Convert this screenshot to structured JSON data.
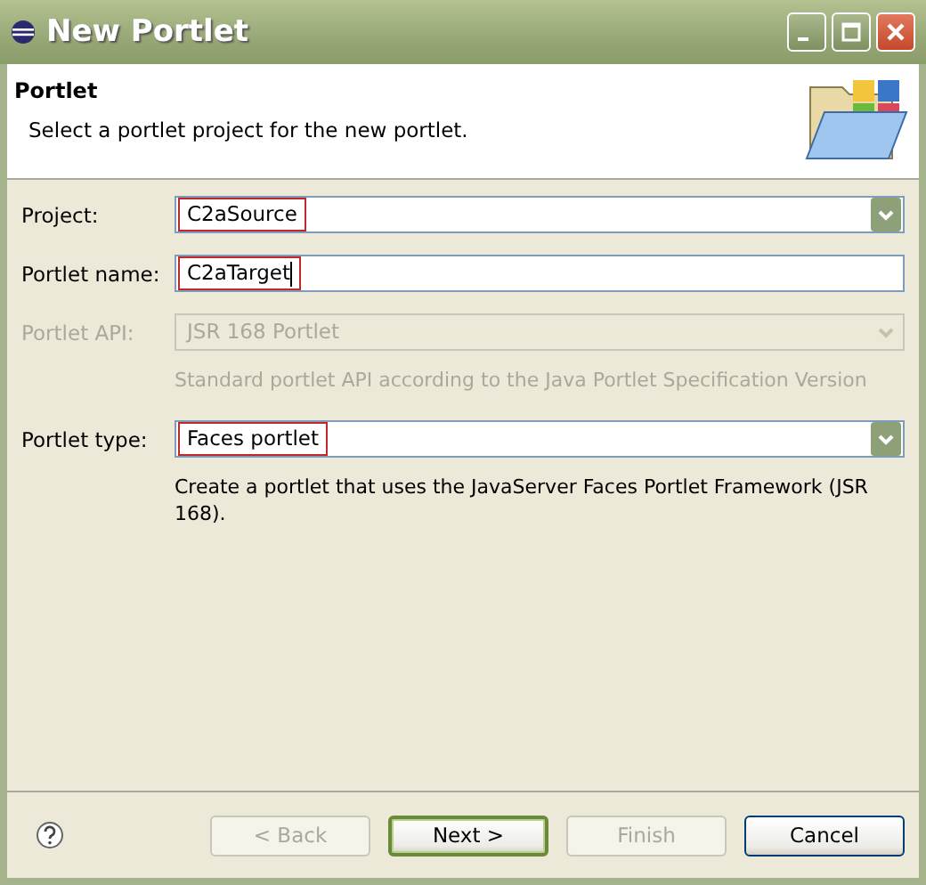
{
  "window": {
    "title": "New Portlet"
  },
  "header": {
    "title": "Portlet",
    "description": "Select a portlet project for the new portlet."
  },
  "fields": [
    {
      "kind": "combo",
      "label": "Project:",
      "value": "C2aSource",
      "disabled": false,
      "highlighted": true
    },
    {
      "kind": "text",
      "label": "Portlet name:",
      "value": "C2aTarget",
      "disabled": false,
      "highlighted": true,
      "focused": true
    },
    {
      "kind": "combo",
      "label": "Portlet API:",
      "value": "JSR 168 Portlet",
      "disabled": true,
      "highlighted": false,
      "note": "Standard portlet API according to the Java Portlet Specification Version"
    },
    {
      "kind": "combo",
      "label": "Portlet type:",
      "value": "Faces portlet",
      "disabled": false,
      "highlighted": true,
      "note": "Create a portlet that uses the JavaServer Faces Portlet Framework (JSR 168)."
    }
  ],
  "buttons": [
    {
      "label": "< Back",
      "disabled": true,
      "default": false
    },
    {
      "label": "Next >",
      "disabled": false,
      "default": true
    },
    {
      "label": "Finish",
      "disabled": true,
      "default": false
    },
    {
      "label": "Cancel",
      "disabled": false,
      "default": false
    }
  ]
}
